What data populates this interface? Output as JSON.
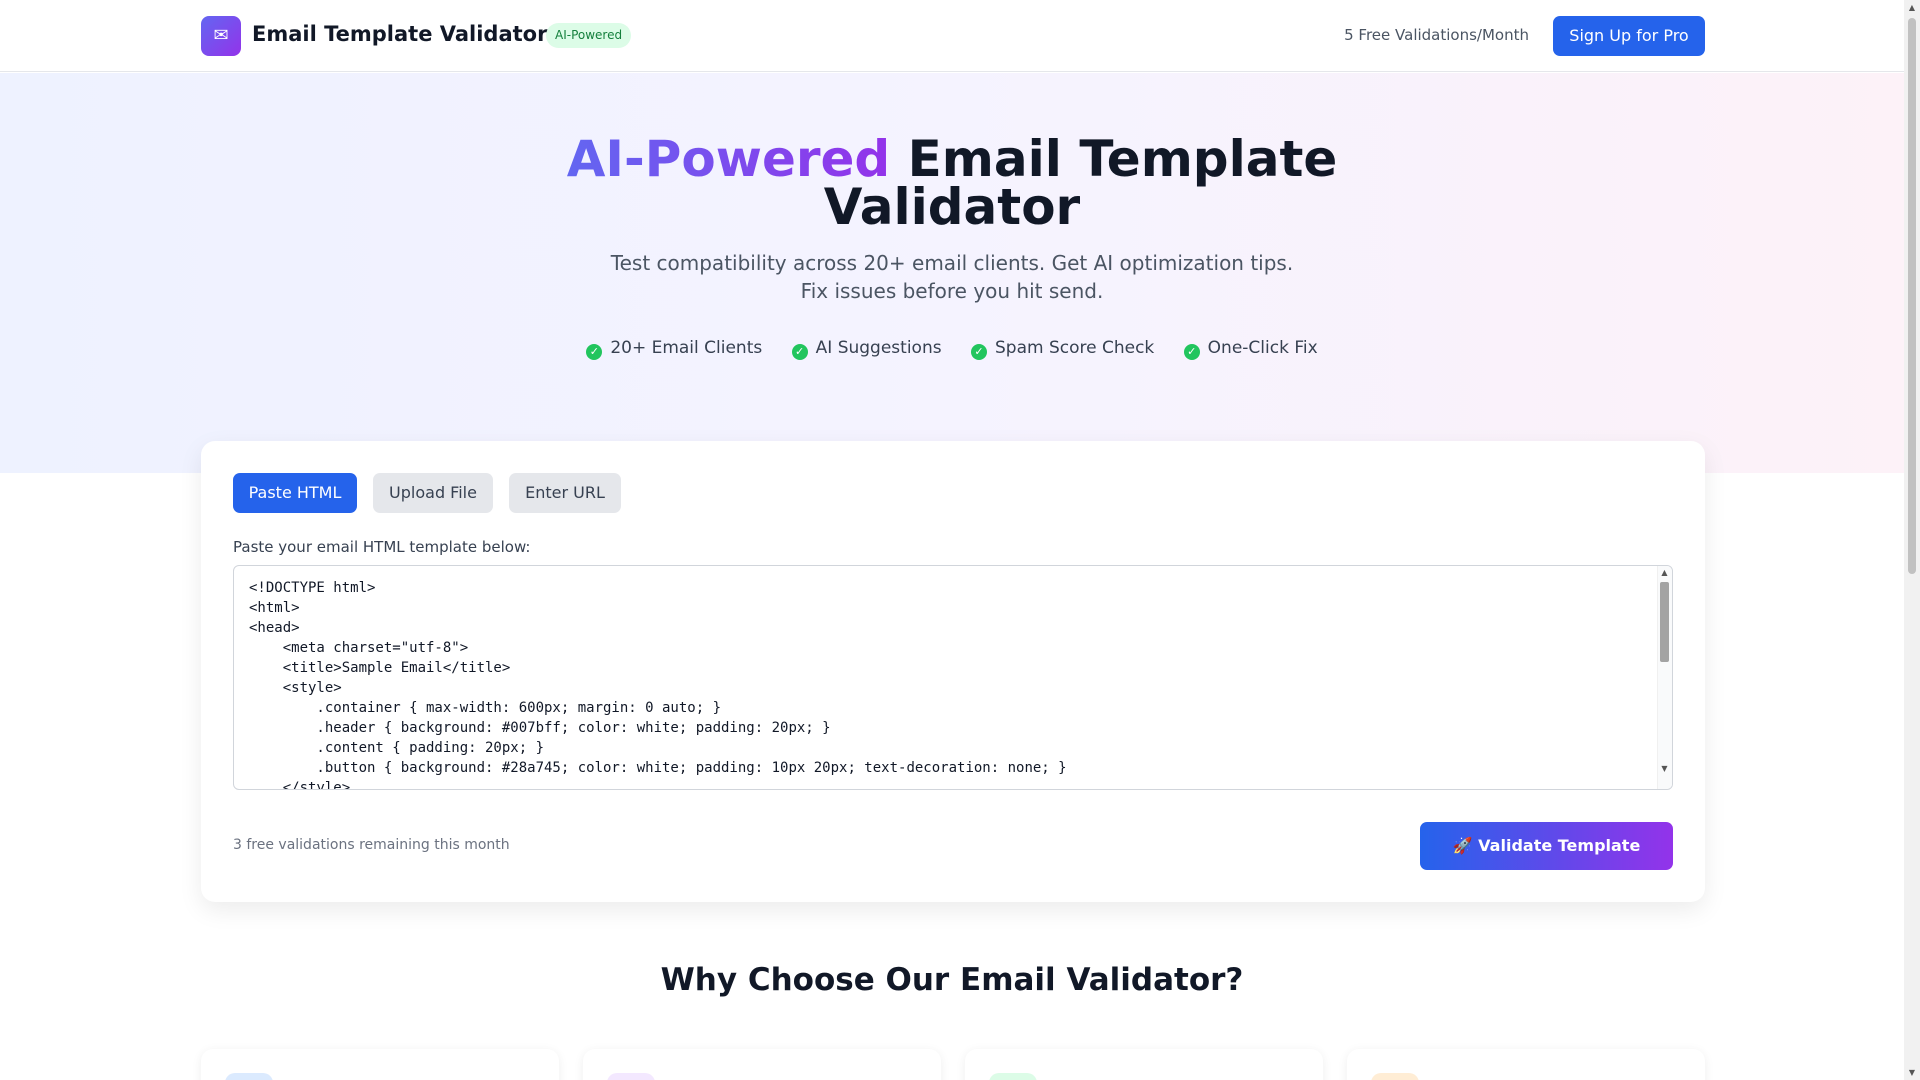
{
  "header": {
    "logo_glyph": "✉",
    "title": "Email Template Validator",
    "badge": "AI-Powered",
    "free_validations": "5 Free Validations/Month",
    "signup_label": "Sign Up for Pro"
  },
  "hero": {
    "title_highlight": "AI-Powered",
    "title_rest_1": "Email Template",
    "title_rest_2": "Validator",
    "subtitle_1": "Test compatibility across 20+ email clients. Get AI optimization tips.",
    "subtitle_2": "Fix issues before you hit send.",
    "features": [
      "20+ Email Clients",
      "AI Suggestions",
      "Spam Score Check",
      "One-Click Fix"
    ]
  },
  "validator": {
    "tabs": [
      "Paste HTML",
      "Upload File",
      "Enter URL"
    ],
    "active_tab": "Paste HTML",
    "paste_label": "Paste your email HTML template below:",
    "code": "<!DOCTYPE html>\n<html>\n<head>\n    <meta charset=\"utf-8\">\n    <title>Sample Email</title>\n    <style>\n        .container { max-width: 600px; margin: 0 auto; }\n        .header { background: #007bff; color: white; padding: 20px; }\n        .content { padding: 20px; }\n        .button { background: #28a745; color: white; padding: 10px 20px; text-decoration: none; }\n    </style>",
    "remaining_text": "3 free validations remaining this month",
    "validate_label": "🚀 Validate Template"
  },
  "why": {
    "title": "Why Choose Our Email Validator?",
    "card_icon_colors": [
      "#dbeafe",
      "#f3e8ff",
      "#dcfce7",
      "#ffedd5"
    ]
  },
  "colors": {
    "primary": "#2563eb",
    "accent": "#9333ea",
    "success": "#22c55e"
  }
}
